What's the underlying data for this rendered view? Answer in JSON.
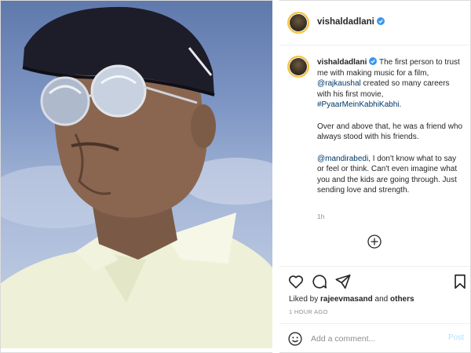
{
  "post": {
    "username": "vishaldadlani",
    "header_avatar_icon": "profile-avatar-icon",
    "verified_icon": "verified-badge-icon",
    "caption": {
      "username": "vishaldadlani",
      "para1_a": "The first person to trust me with making music for a film, ",
      "mention1": "@rajkaushal",
      "para1_b": " created so many careers with his first movie, ",
      "hashtag": "#PyaarMeinKabhiKabhi",
      "para1_c": ".",
      "para2": "Over and above that, he was a friend who always stood with his friends.",
      "mention2": "@mandirabedi",
      "para3": ", I don't know what to say or feel or think. Can't even imagine what you and the kids are going through. Just sending love and strength."
    },
    "caption_time": "1h",
    "load_more_icon": "plus-circle-icon"
  },
  "actions": {
    "like_icon": "heart-icon",
    "comment_icon": "comment-icon",
    "share_icon": "send-icon",
    "save_icon": "bookmark-icon"
  },
  "likes": {
    "prefix": "Liked by ",
    "user": "rajeevmasand",
    "middle": " and ",
    "others": "others"
  },
  "timestamp": "1 HOUR AGO",
  "comment": {
    "emoji_icon": "smiley-icon",
    "placeholder": "Add a comment...",
    "post_label": "Post"
  },
  "colors": {
    "link": "#00376b",
    "post_disabled": "#b2dffc",
    "story_ring": "#f6c444",
    "border": "#dbdbdb"
  }
}
